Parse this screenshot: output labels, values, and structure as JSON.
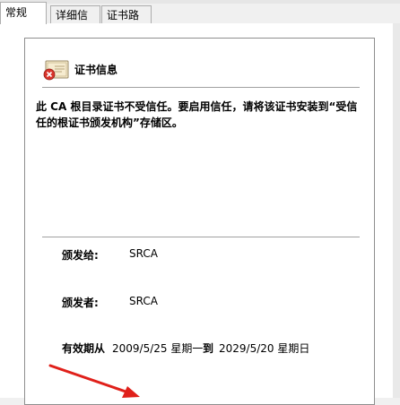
{
  "tabs": [
    {
      "label": "常规",
      "active": true
    },
    {
      "label": "详细信息",
      "active": false
    },
    {
      "label": "证书路径",
      "active": false
    }
  ],
  "certificate": {
    "title": "证书信息",
    "icon": "certificate-error-icon",
    "warning": "此 CA 根目录证书不受信任。要启用信任，请将该证书安装到“受信任的根证书颁发机构”存储区。"
  },
  "fields": {
    "issued_to_label": "颁发给:",
    "issued_to_value": "SRCA",
    "issued_by_label": "颁发者:",
    "issued_by_value": "SRCA",
    "validity_label": "有效期从",
    "validity_from": "2009/5/25 星期一",
    "validity_to_label": "到",
    "validity_to": "2029/5/20 星期日"
  },
  "colors": {
    "annotation_arrow": "#e0201a",
    "error_badge": "#d9342b"
  }
}
